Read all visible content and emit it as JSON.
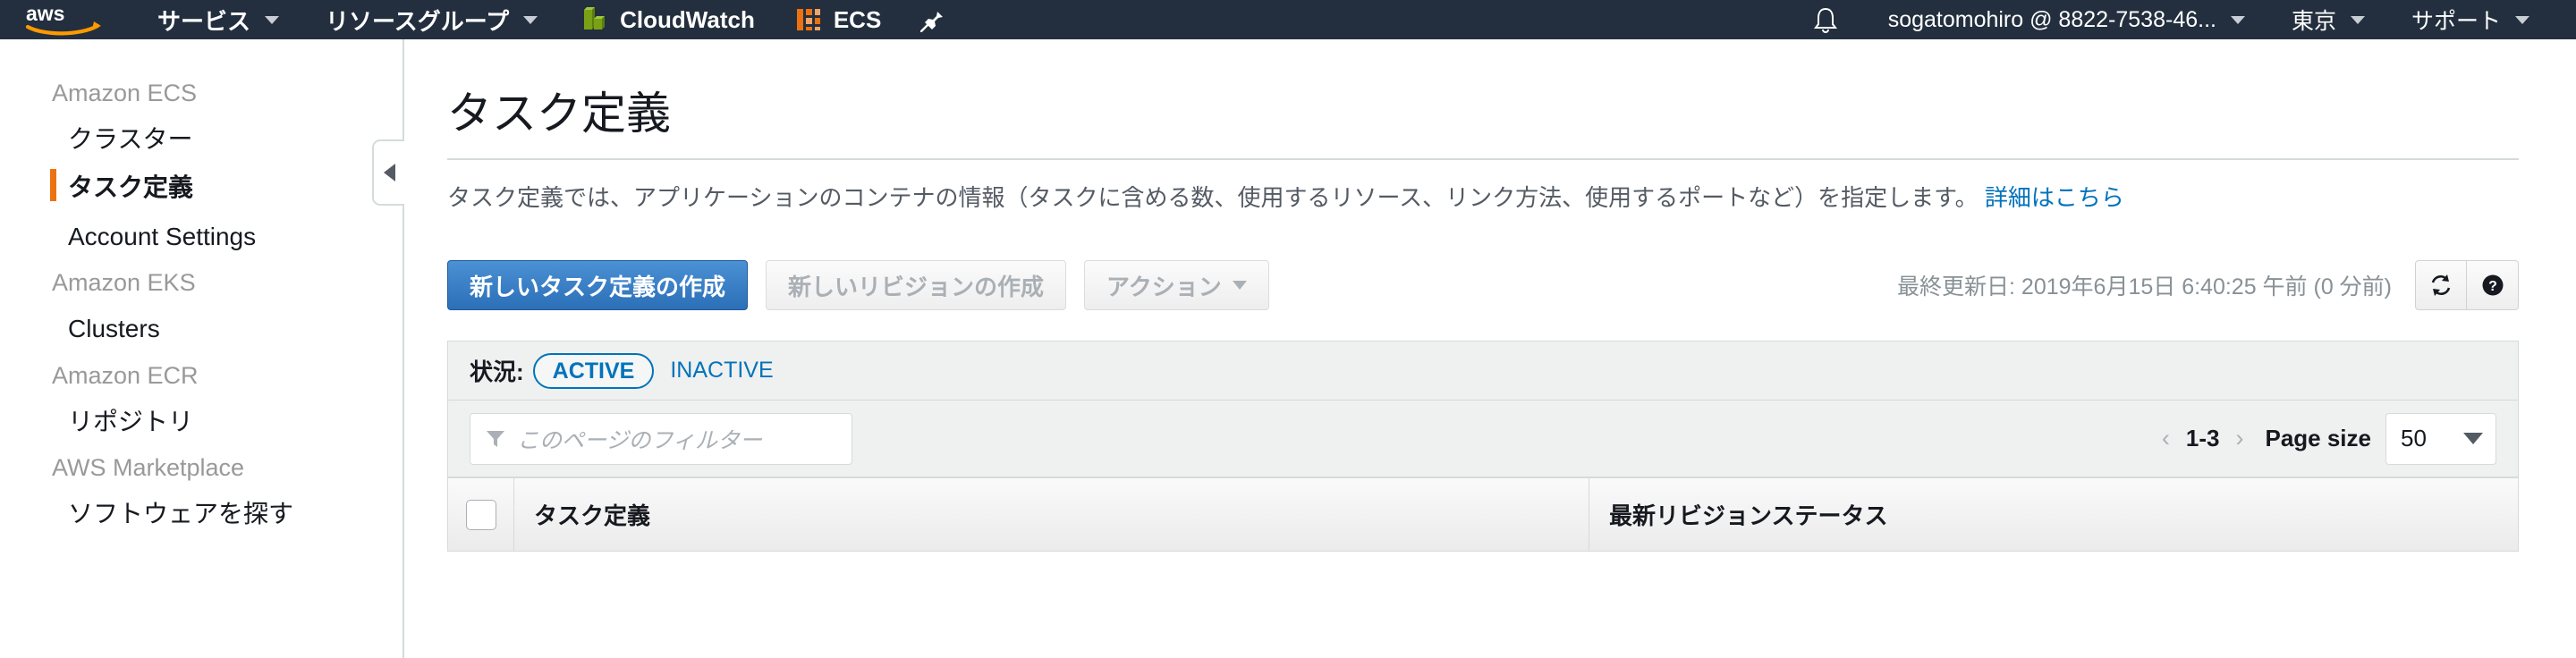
{
  "topnav": {
    "logo": "aws-logo",
    "items": [
      {
        "label": "サービス",
        "icon": "none",
        "caret": true
      },
      {
        "label": "リソースグループ",
        "icon": "none",
        "caret": true
      }
    ],
    "services": [
      {
        "label": "CloudWatch",
        "icon": "cloudwatch-icon"
      },
      {
        "label": "ECS",
        "icon": "ecs-icon"
      }
    ],
    "pin_icon": "pin-icon",
    "bell_icon": "bell-icon",
    "account": "sogatomohiro @ 8822-7538-46...",
    "region": "東京",
    "support": "サポート"
  },
  "sidebar": {
    "groups": [
      {
        "title": "Amazon ECS",
        "links": [
          {
            "label": "クラスター",
            "selected": false
          },
          {
            "label": "タスク定義",
            "selected": true
          },
          {
            "label": "Account Settings",
            "selected": false
          }
        ]
      },
      {
        "title": "Amazon EKS",
        "links": [
          {
            "label": "Clusters",
            "selected": false
          }
        ]
      },
      {
        "title": "Amazon ECR",
        "links": [
          {
            "label": "リポジトリ",
            "selected": false
          }
        ]
      },
      {
        "title": "AWS Marketplace",
        "links": [
          {
            "label": "ソフトウェアを探す",
            "selected": false
          }
        ]
      }
    ],
    "collapse_icon": "chevron-left-icon"
  },
  "main": {
    "title": "タスク定義",
    "description": "タスク定義では、アプリケーションのコンテナの情報（タスクに含める数、使用するリソース、リンク方法、使用するポートなど）を指定します。",
    "description_link": "詳細はこちら",
    "buttons": {
      "create_task_definition": "新しいタスク定義の作成",
      "create_revision": "新しいリビジョンの作成",
      "actions": "アクション"
    },
    "last_updated": "最終更新日: 2019年6月15日 6:40:25 午前 (0 分前)",
    "refresh_icon": "refresh-icon",
    "help_icon": "help-icon"
  },
  "filters": {
    "status_label": "状況:",
    "status_active": "ACTIVE",
    "status_inactive": "INACTIVE",
    "filter_placeholder": "このページのフィルター",
    "filter_value": "",
    "filter_icon": "funnel-icon",
    "pager": {
      "prev": "‹",
      "range": "1-3",
      "next": "›",
      "page_size_label": "Page size",
      "page_size_value": "50"
    }
  },
  "table": {
    "columns": [
      {
        "label": "タスク定義"
      },
      {
        "label": "最新リビジョンステータス"
      }
    ],
    "select_all_checkbox": "unchecked"
  },
  "colors": {
    "nav_bg": "#232f3e",
    "accent_orange": "#ec7211",
    "link_blue": "#0073bb",
    "primary_button": "#2b6fb8",
    "panel_bg": "#eff0f0",
    "border": "#d5dbdb"
  }
}
